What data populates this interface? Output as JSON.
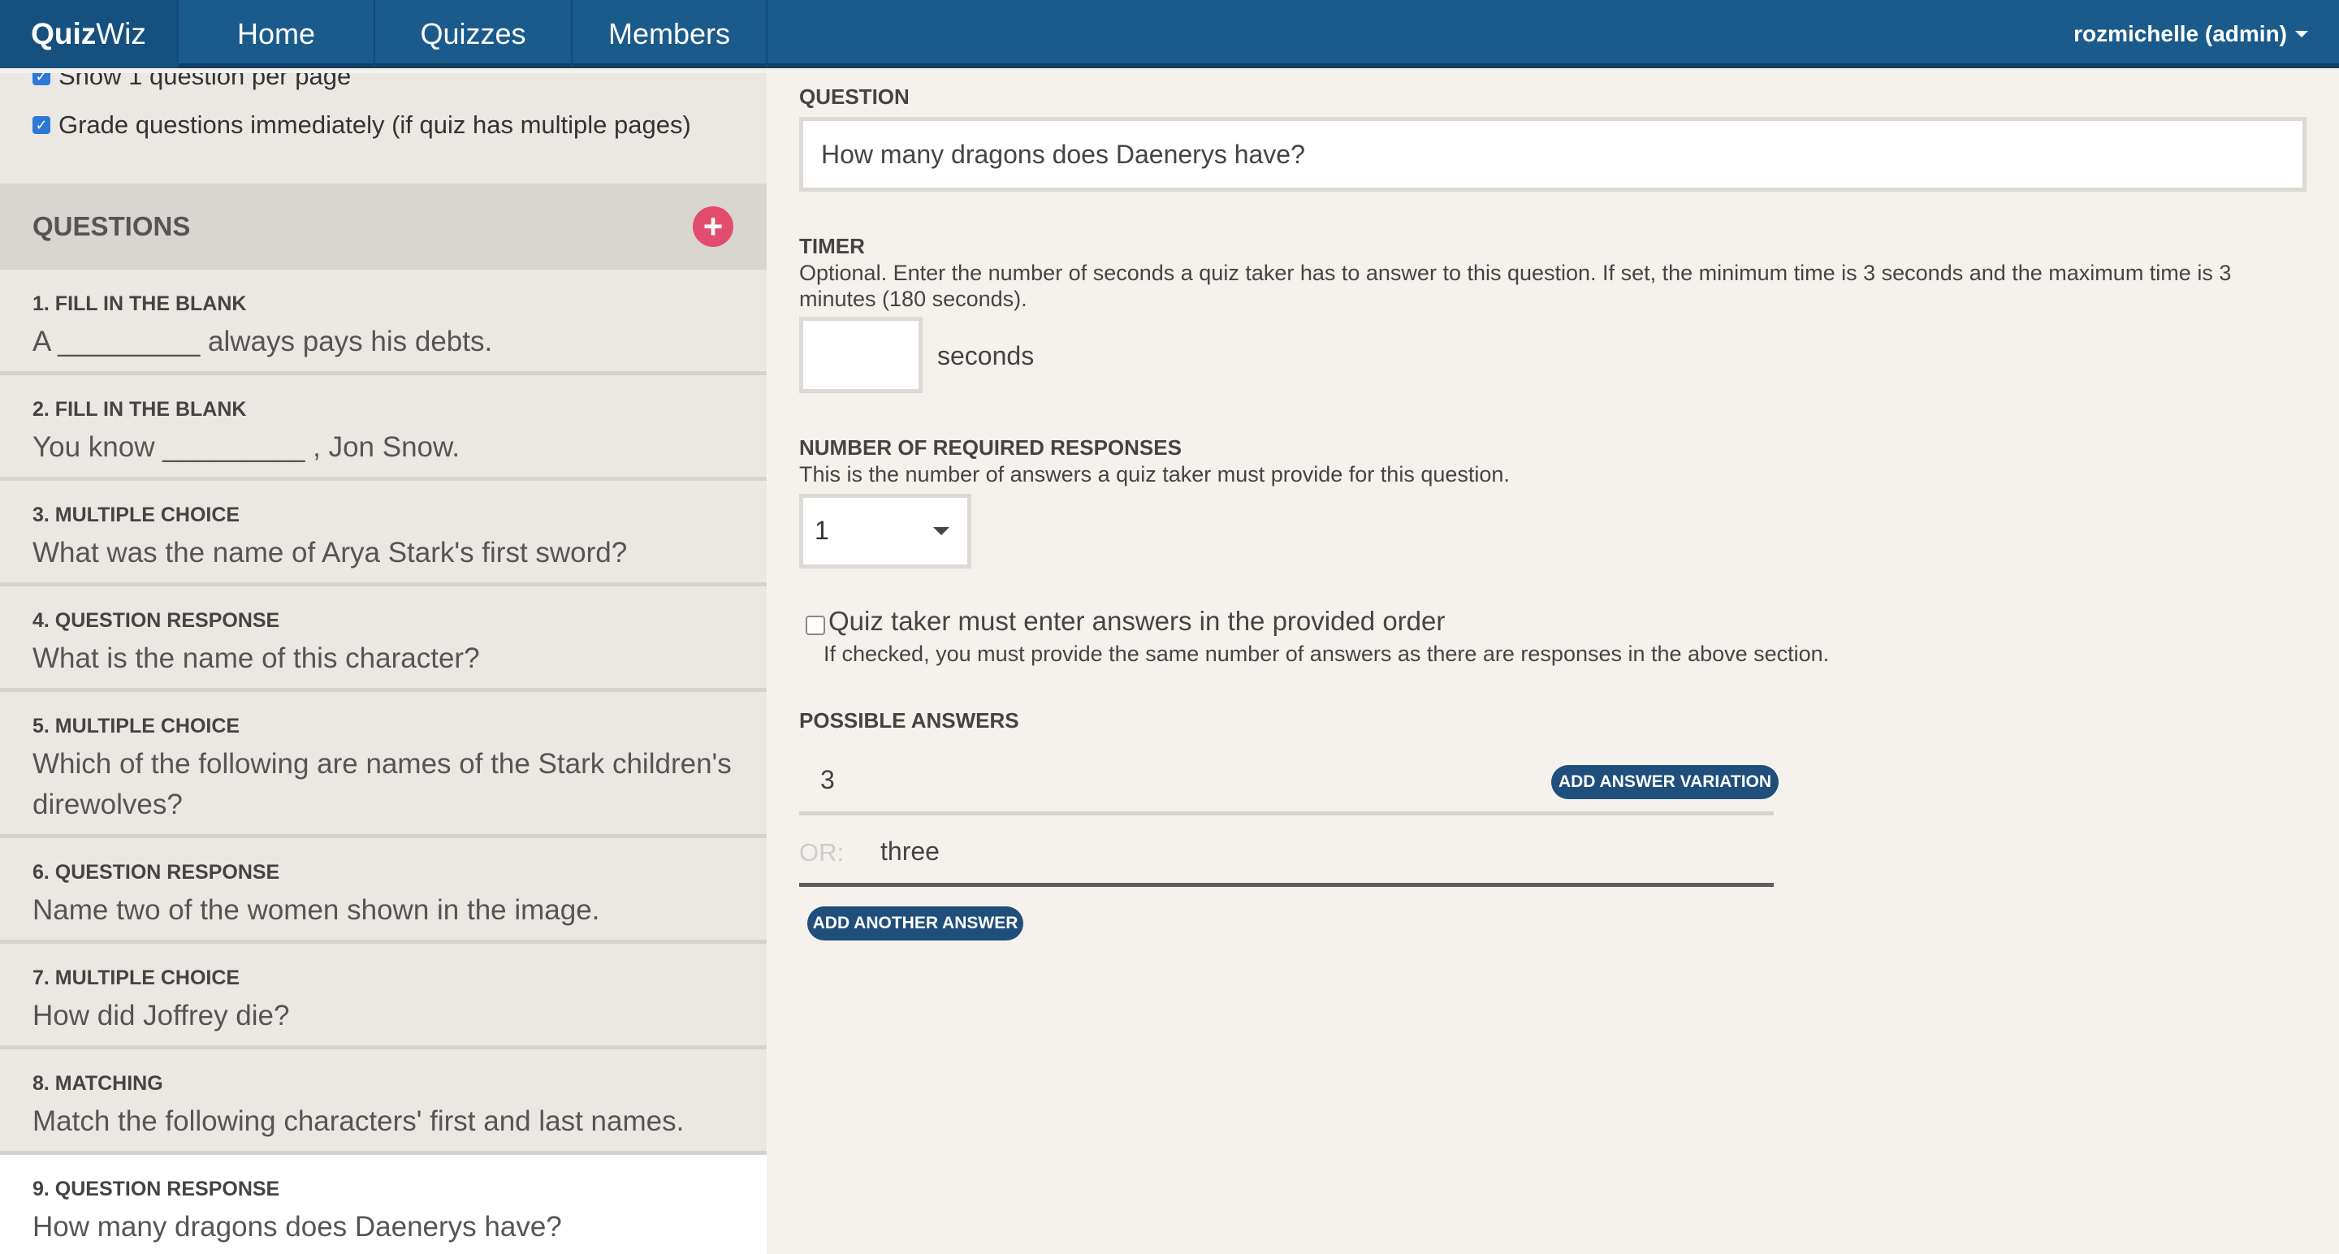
{
  "nav": {
    "brand_bold": "Quiz",
    "brand_light": "Wiz",
    "items": [
      "Home",
      "Quizzes",
      "Members"
    ],
    "user": "rozmichelle (admin)"
  },
  "sidebar": {
    "options": [
      {
        "label": "Show 1 question per page",
        "checked": true
      },
      {
        "label": "Grade questions immediately (if quiz has multiple pages)",
        "checked": true
      }
    ],
    "questions_title": "QUESTIONS",
    "questions": [
      {
        "type": "1. FILL IN THE BLANK",
        "text": "A _________ always pays his debts."
      },
      {
        "type": "2. FILL IN THE BLANK",
        "text": "You know _________ , Jon Snow."
      },
      {
        "type": "3. MULTIPLE CHOICE",
        "text": "What was the name of Arya Stark's first sword?"
      },
      {
        "type": "4. QUESTION RESPONSE",
        "text": "What is the name of this character?"
      },
      {
        "type": "5. MULTIPLE CHOICE",
        "text": "Which of the following are names of the Stark children's direwolves?"
      },
      {
        "type": "6. QUESTION RESPONSE",
        "text": "Name two of the women shown in the image."
      },
      {
        "type": "7. MULTIPLE CHOICE",
        "text": "How did Joffrey die?"
      },
      {
        "type": "8. MATCHING",
        "text": "Match the following characters' first and last names."
      },
      {
        "type": "9. QUESTION RESPONSE",
        "text": "How many dragons does Daenerys have?"
      }
    ],
    "active_question": 9
  },
  "editor": {
    "question_label": "QUESTION",
    "question_value": "How many dragons does Daenerys have?",
    "timer_label": "TIMER",
    "timer_help": "Optional. Enter the number of seconds a quiz taker has to answer to this question. If set, the minimum time is 3 seconds and the maximum time is 3 minutes (180 seconds).",
    "timer_value": "",
    "timer_unit": "seconds",
    "required_label": "NUMBER OF REQUIRED RESPONSES",
    "required_help": "This is the number of answers a quiz taker must provide for this question.",
    "required_value": "1",
    "order_label": "Quiz taker must enter answers in the provided order",
    "order_checked": false,
    "order_help": "If checked, you must provide the same number of answers as there are responses in the above section.",
    "answers_label": "POSSIBLE ANSWERS",
    "answers": [
      "3",
      "three"
    ],
    "or_label": "OR:",
    "add_variation_label": "ADD ANSWER VARIATION",
    "add_another_label": "ADD ANOTHER ANSWER"
  },
  "colors": {
    "navbar": "#1b5b8c",
    "brand_bg": "#15507e",
    "add_button": "#e34d6d",
    "pill_button": "#1f4f7a",
    "checkbox": "#2b78d6"
  }
}
